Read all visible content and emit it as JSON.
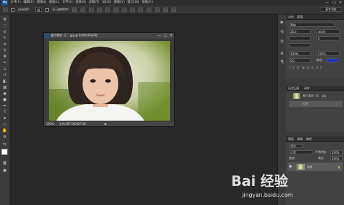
{
  "app": {
    "logo": "Ps"
  },
  "menubar": {
    "items": [
      "文件(F)",
      "编辑(E)",
      "图像(I)",
      "图层(L)",
      "文字(Y)",
      "选择(S)",
      "滤镜(T)",
      "3D(D)",
      "视图(V)",
      "窗口(W)",
      "帮助(H)"
    ],
    "window_controls": [
      "—",
      "□",
      "✕"
    ]
  },
  "options_bar": {
    "auto_select_label": "自动选择：",
    "auto_select_value": "组",
    "show_transform_label": "显示变换控件",
    "workspace": "基本功能"
  },
  "document": {
    "title": "图片素材（1）.jpg @ 100%(RGB/8)",
    "zoom": "100%",
    "status": "文档:457.0K/457.0K",
    "status_arrow": "▶"
  },
  "panels": {
    "color_tabs": [
      "字符",
      "段落"
    ],
    "font_family": "黑体",
    "font_size": "25点",
    "leading": "(自动)",
    "tracking": "0",
    "vertical_scale": "100%",
    "horizontal_scale": "100%",
    "baseline": "0点",
    "color_label": "颜色:",
    "color_value": "#1c33c9",
    "history_tabs": [
      "历史记录",
      "动作"
    ],
    "history_items": [
      "图片素材（1）.jpg",
      "打开"
    ],
    "layers_tabs": [
      "图层",
      "通道",
      "路径"
    ],
    "layer_kind": "类型",
    "blend_mode": "正常",
    "opacity_label": "不透明度:",
    "opacity_value": "100%",
    "lock_label": "锁定:",
    "fill_label": "填充:",
    "fill_value": "100%",
    "layer_name": "背景"
  },
  "watermark": {
    "brand": "Bai 经验",
    "url": "jingyan.baidu.com"
  }
}
